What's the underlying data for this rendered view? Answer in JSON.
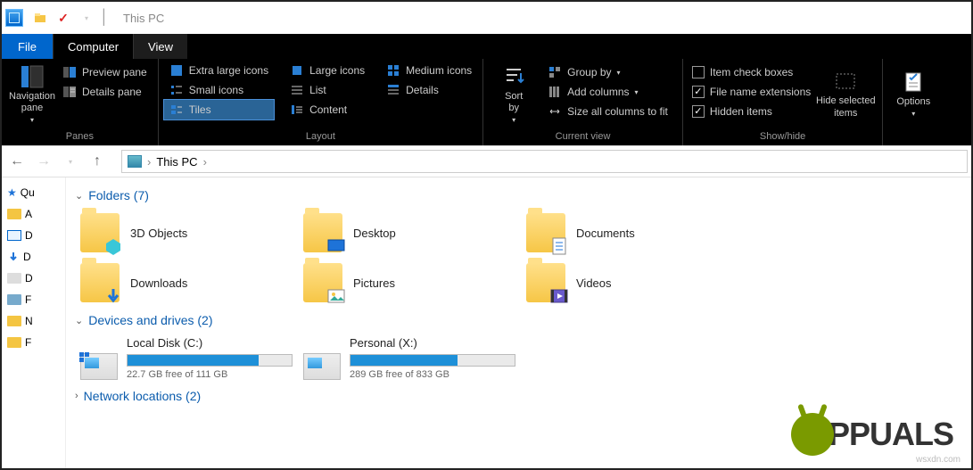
{
  "title": "This PC",
  "menubar": {
    "file": "File",
    "computer": "Computer",
    "view": "View"
  },
  "ribbon": {
    "panes": {
      "navigation": "Navigation\npane",
      "preview": "Preview pane",
      "details": "Details pane",
      "label": "Panes"
    },
    "layout": {
      "extra_large": "Extra large icons",
      "large": "Large icons",
      "medium": "Medium icons",
      "small": "Small icons",
      "list": "List",
      "details": "Details",
      "tiles": "Tiles",
      "content": "Content",
      "label": "Layout"
    },
    "current_view": {
      "sort_by": "Sort\nby",
      "group_by": "Group by",
      "add_columns": "Add columns",
      "size_all": "Size all columns to fit",
      "label": "Current view"
    },
    "show_hide": {
      "item_check": "Item check boxes",
      "file_ext": "File name extensions",
      "hidden": "Hidden items",
      "hide_selected": "Hide selected\nitems",
      "label": "Show/hide",
      "checks": {
        "item_check": false,
        "file_ext": true,
        "hidden": true
      }
    },
    "options": {
      "label": "Options"
    }
  },
  "breadcrumb": {
    "location": "This PC"
  },
  "sidebar": {
    "quick": "Qu",
    "items": [
      "A",
      "D",
      "D",
      "D",
      "F",
      "N",
      "F"
    ]
  },
  "sections": {
    "folders": {
      "title": "Folders (7)",
      "items": [
        "3D Objects",
        "Desktop",
        "Documents",
        "Downloads",
        "Pictures",
        "Videos"
      ]
    },
    "drives": {
      "title": "Devices and drives (2)",
      "items": [
        {
          "name": "Local Disk (C:)",
          "free_text": "22.7 GB free of 111 GB",
          "fill_pct": 80
        },
        {
          "name": "Personal (X:)",
          "free_text": "289 GB free of 833 GB",
          "fill_pct": 65
        }
      ]
    },
    "network": {
      "title": "Network locations (2)"
    }
  },
  "watermark": {
    "text": "PPUALS",
    "attribution": "wsxdn.com"
  }
}
